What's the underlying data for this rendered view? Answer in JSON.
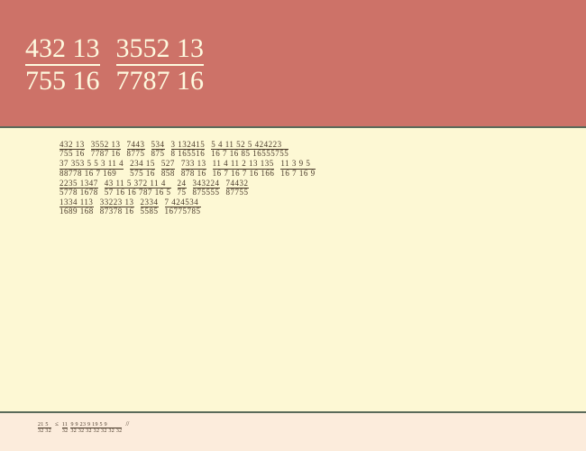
{
  "header": {
    "fracs": [
      {
        "num": "432 13",
        "den": "755 16"
      },
      {
        "num": "3552 13",
        "den": "7787 16"
      }
    ]
  },
  "abstract": {
    "lines": [
      [
        {
          "num": "432 13",
          "den": "755 16"
        },
        {
          "num": "3552 13",
          "den": "7787 16"
        },
        {
          "num": "7443",
          "den": "8775"
        },
        {
          "num": "534",
          "den": "875"
        },
        {
          "num": "3 132415",
          "den": "8 165516"
        },
        {
          "num": "5 4 11 52 5 424223",
          "den": "16 7 16 85 16555755"
        }
      ],
      [
        {
          "num": "37 353 5 5 3 11 4",
          "den": "88778 16 7 169"
        },
        {
          "num": "234 15",
          "den": "575 16"
        },
        {
          "num": "527",
          "den": "858"
        },
        {
          "num": "733 13",
          "den": "878 16"
        },
        {
          "num": "11 4 11 2 13 135",
          "den": "16 7 16 7 16 166"
        },
        {
          "num": "11 3 9 5",
          "den": "16 7 16 9"
        }
      ],
      [
        {
          "num": "2235 1347",
          "den": "5778 1678"
        },
        {
          "num": "43 11 5 372 11 4",
          "den": "57 16 16 787 16 5"
        },
        {
          "num": "24",
          "den": "75"
        },
        {
          "num": "343224",
          "den": "875555"
        },
        {
          "num": "74432",
          "den": "87755"
        }
      ],
      [
        {
          "num": "1334 113",
          "den": "1689 168"
        },
        {
          "num": "33223 13",
          "den": "87378 16"
        },
        {
          "num": "2334",
          "den": "5585"
        },
        {
          "num": "7 424534",
          "den": "16775785"
        }
      ]
    ]
  },
  "footer": {
    "fracs": [
      {
        "num": "21 5",
        "den": "32 32"
      },
      {
        "num": "11",
        "den": "32"
      },
      {
        "num": "9 9 23 9 19 5 9",
        "den": "32 32 32 32 32 32 32"
      }
    ],
    "separators": [
      "≤",
      ""
    ],
    "tail": "//"
  }
}
